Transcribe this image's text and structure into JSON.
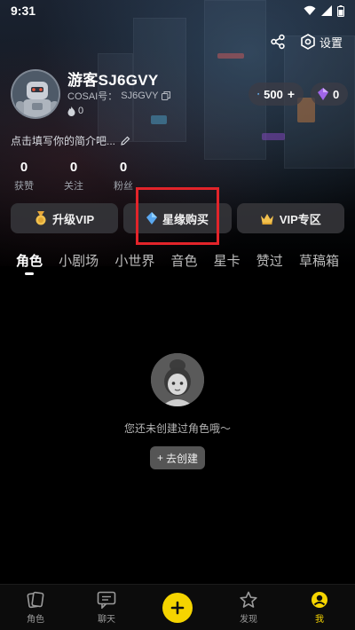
{
  "status_bar": {
    "time": "9:31"
  },
  "header": {
    "settings_label": "设置"
  },
  "profile": {
    "username": "游客SJ6GVY",
    "cosai_prefix": "COSAI号：",
    "cosai_id": "SJ6GVY",
    "fire_count": "0",
    "crystal_balance": "500",
    "gem_balance": "0",
    "bio_placeholder": "点击填写你的简介吧..."
  },
  "stats": [
    {
      "value": "0",
      "label": "获赞"
    },
    {
      "value": "0",
      "label": "关注"
    },
    {
      "value": "0",
      "label": "粉丝"
    }
  ],
  "actions": {
    "upgrade_vip": "升级VIP",
    "xingyuan_buy": "星缘购买",
    "vip_zone": "VIP专区"
  },
  "tabs": [
    "角色",
    "小剧场",
    "小世界",
    "音色",
    "星卡",
    "赞过",
    "草稿箱"
  ],
  "empty_state": {
    "message": "您还未创建过角色哦～",
    "create_label": "去创建"
  },
  "bottom_nav": [
    {
      "label": "角色"
    },
    {
      "label": "聊天"
    },
    {
      "label": ""
    },
    {
      "label": "发现"
    },
    {
      "label": "我"
    }
  ],
  "colors": {
    "accent": "#f5d400",
    "highlight_border": "#e2242a",
    "button_bg": "#343438"
  }
}
